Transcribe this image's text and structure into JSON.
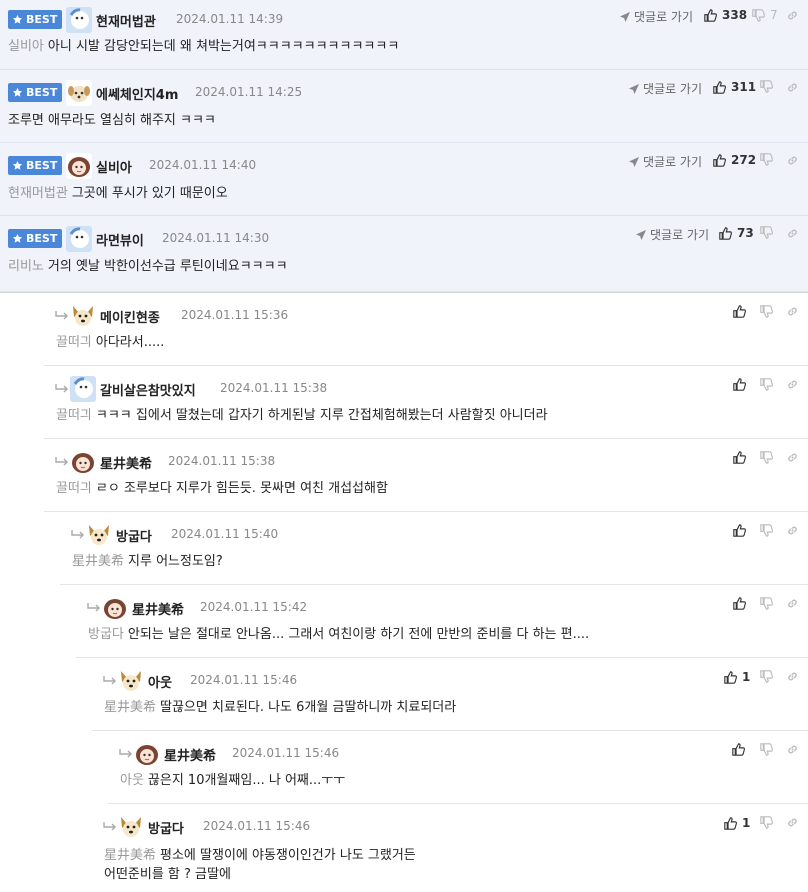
{
  "best_label": "BEST",
  "goto_label": "댓글로 가기",
  "best_comments": [
    {
      "nick": "현재머법관",
      "date": "2024.01.11 14:39",
      "mention": "실비아",
      "text": "아니 시발 감당안되는데 왜 쳐박는거여ㅋㅋㅋㅋㅋㅋㅋㅋㅋㅋㅋㅋ",
      "likes": "338",
      "dislikes": "7"
    },
    {
      "nick": "에쎄체인지4m",
      "date": "2024.01.11 14:25",
      "mention": "",
      "text": "조루면 애무라도 열심히 해주지 ㅋㅋㅋ",
      "likes": "311",
      "dislikes": ""
    },
    {
      "nick": "실비아",
      "date": "2024.01.11 14:40",
      "mention": "현재머법관",
      "text": "그곳에 푸시가 있기 때문이오",
      "likes": "272",
      "dislikes": ""
    },
    {
      "nick": "라면뷰이",
      "date": "2024.01.11 14:30",
      "mention": "리비노",
      "text": "거의 옛날 박한이선수급 루틴이네요ㅋㅋㅋㅋ",
      "likes": "73",
      "dislikes": ""
    }
  ],
  "replies": [
    {
      "nick": "메이킨현종",
      "date": "2024.01.11 15:36",
      "mention": "끌떠긔",
      "text": "아다라서.....",
      "likes": ""
    },
    {
      "nick": "갈비살은참맛있지",
      "date": "2024.01.11 15:38",
      "mention": "끌떠긔",
      "text": "ㅋㅋㅋ 집에서 딸쳤는데 갑자기 하게된날 지루 간접체험해봤는더 사람할짓 아니더라",
      "likes": ""
    },
    {
      "nick": "星井美希",
      "date": "2024.01.11 15:38",
      "mention": "끌떠긔",
      "text": "ㄹㅇ 조루보다 지루가 힘든듯. 못싸면 여친 개섭섭해함",
      "likes": ""
    },
    {
      "nick": "방굽다",
      "date": "2024.01.11 15:40",
      "mention": "星井美希",
      "text": "지루 어느정도임?",
      "likes": ""
    },
    {
      "nick": "星井美希",
      "date": "2024.01.11 15:42",
      "mention": "방굽다",
      "text": "안되는 날은 절대로 안나옴... 그래서 여친이랑 하기 전에 만반의 준비를 다 하는 편....",
      "likes": ""
    },
    {
      "nick": "아웃",
      "date": "2024.01.11 15:46",
      "mention": "星井美希",
      "text": "딸끊으면 치료된다. 나도 6개월 금딸하니까 치료되더라",
      "likes": "1"
    },
    {
      "nick": "星井美希",
      "date": "2024.01.11 15:46",
      "mention": "아웃",
      "text": "끊은지 10개월째임... 나 어째...ㅜㅜ",
      "likes": ""
    },
    {
      "nick": "방굽다",
      "date": "2024.01.11 15:46",
      "mention": "星井美希",
      "text": "평소에 딸쟁이에 야동쟁이인건가 나도 그랬거든",
      "text2": "어떤준비를 함 ? 금딸에",
      "likes": "1"
    }
  ]
}
